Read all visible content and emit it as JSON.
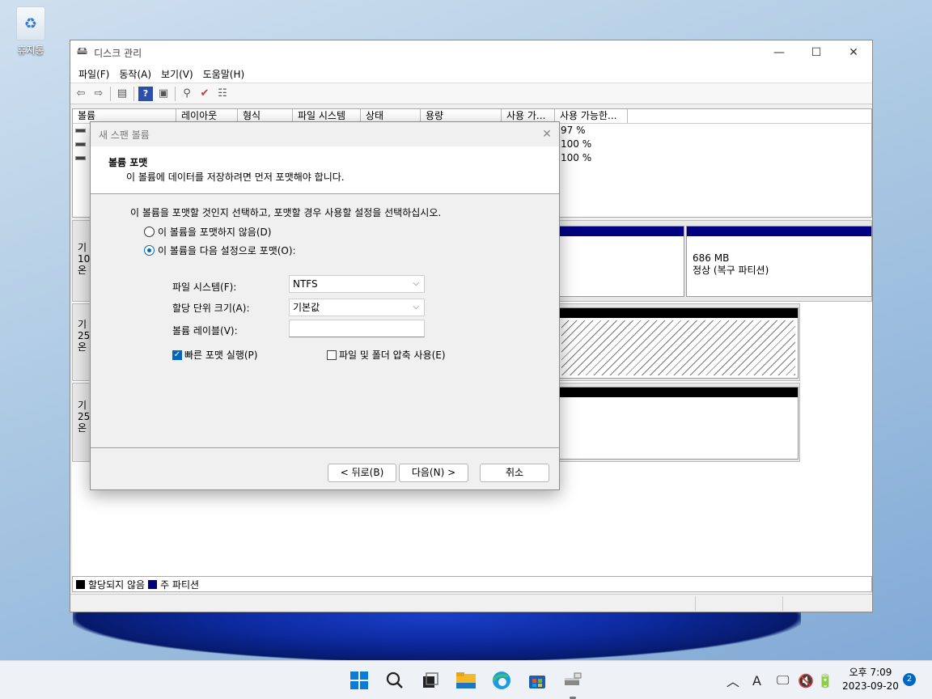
{
  "desktop": {
    "recycle_label": "휴지통"
  },
  "window": {
    "title": "디스크 관리",
    "menu": [
      "파일(F)",
      "동작(A)",
      "보기(V)",
      "도움말(H)"
    ],
    "volume_columns": [
      "볼륨",
      "레이아웃",
      "형식",
      "파일 시스템",
      "상태",
      "용량",
      "사용 가...",
      "사용 가능한..."
    ],
    "volume_rows": [
      {
        "pct": "97 %"
      },
      {
        "pct": "100 %"
      },
      {
        "pct": "100 %"
      }
    ],
    "disk_labels": [
      {
        "l1": "기",
        "l2": "10",
        "l3": "온"
      },
      {
        "l1": "기",
        "l2": "25",
        "l3": "온"
      },
      {
        "l1": "기",
        "l2": "25",
        "l3": "온"
      }
    ],
    "recovery_partition": {
      "size": "686 MB",
      "status": "정상 (복구 파티션)"
    },
    "legend": {
      "unallocated": "할당되지 않음",
      "primary": "주 파티션"
    },
    "colors": {
      "primary": "#000080",
      "unallocated": "#000000"
    }
  },
  "dialog": {
    "title": "새 스팬 볼륨",
    "header_title": "볼륨 포맷",
    "header_subtitle": "이 볼륨에 데이터를 저장하려면 먼저 포맷해야 합니다.",
    "instruction": "이 볼륨을 포맷할 것인지 선택하고, 포맷할 경우 사용할 설정을 선택하십시오.",
    "radio_no_format": "이 볼륨을 포맷하지 않음(D)",
    "radio_format": "이 볼륨을 다음 설정으로 포맷(O):",
    "fs_label": "파일 시스템(F):",
    "fs_value": "NTFS",
    "alloc_label": "할당 단위 크기(A):",
    "alloc_value": "기본값",
    "vol_label_label": "볼륨 레이블(V):",
    "vol_label_value": "",
    "quick_format": "빠른 포맷 실행(P)",
    "compression": "파일 및 폴더 압축 사용(E)",
    "back_button": "< 뒤로(B)",
    "next_button": "다음(N) >",
    "cancel_button": "취소"
  },
  "taskbar": {
    "time": "오후 7:09",
    "date": "2023-09-20",
    "notifications": "2",
    "ime": "A"
  }
}
